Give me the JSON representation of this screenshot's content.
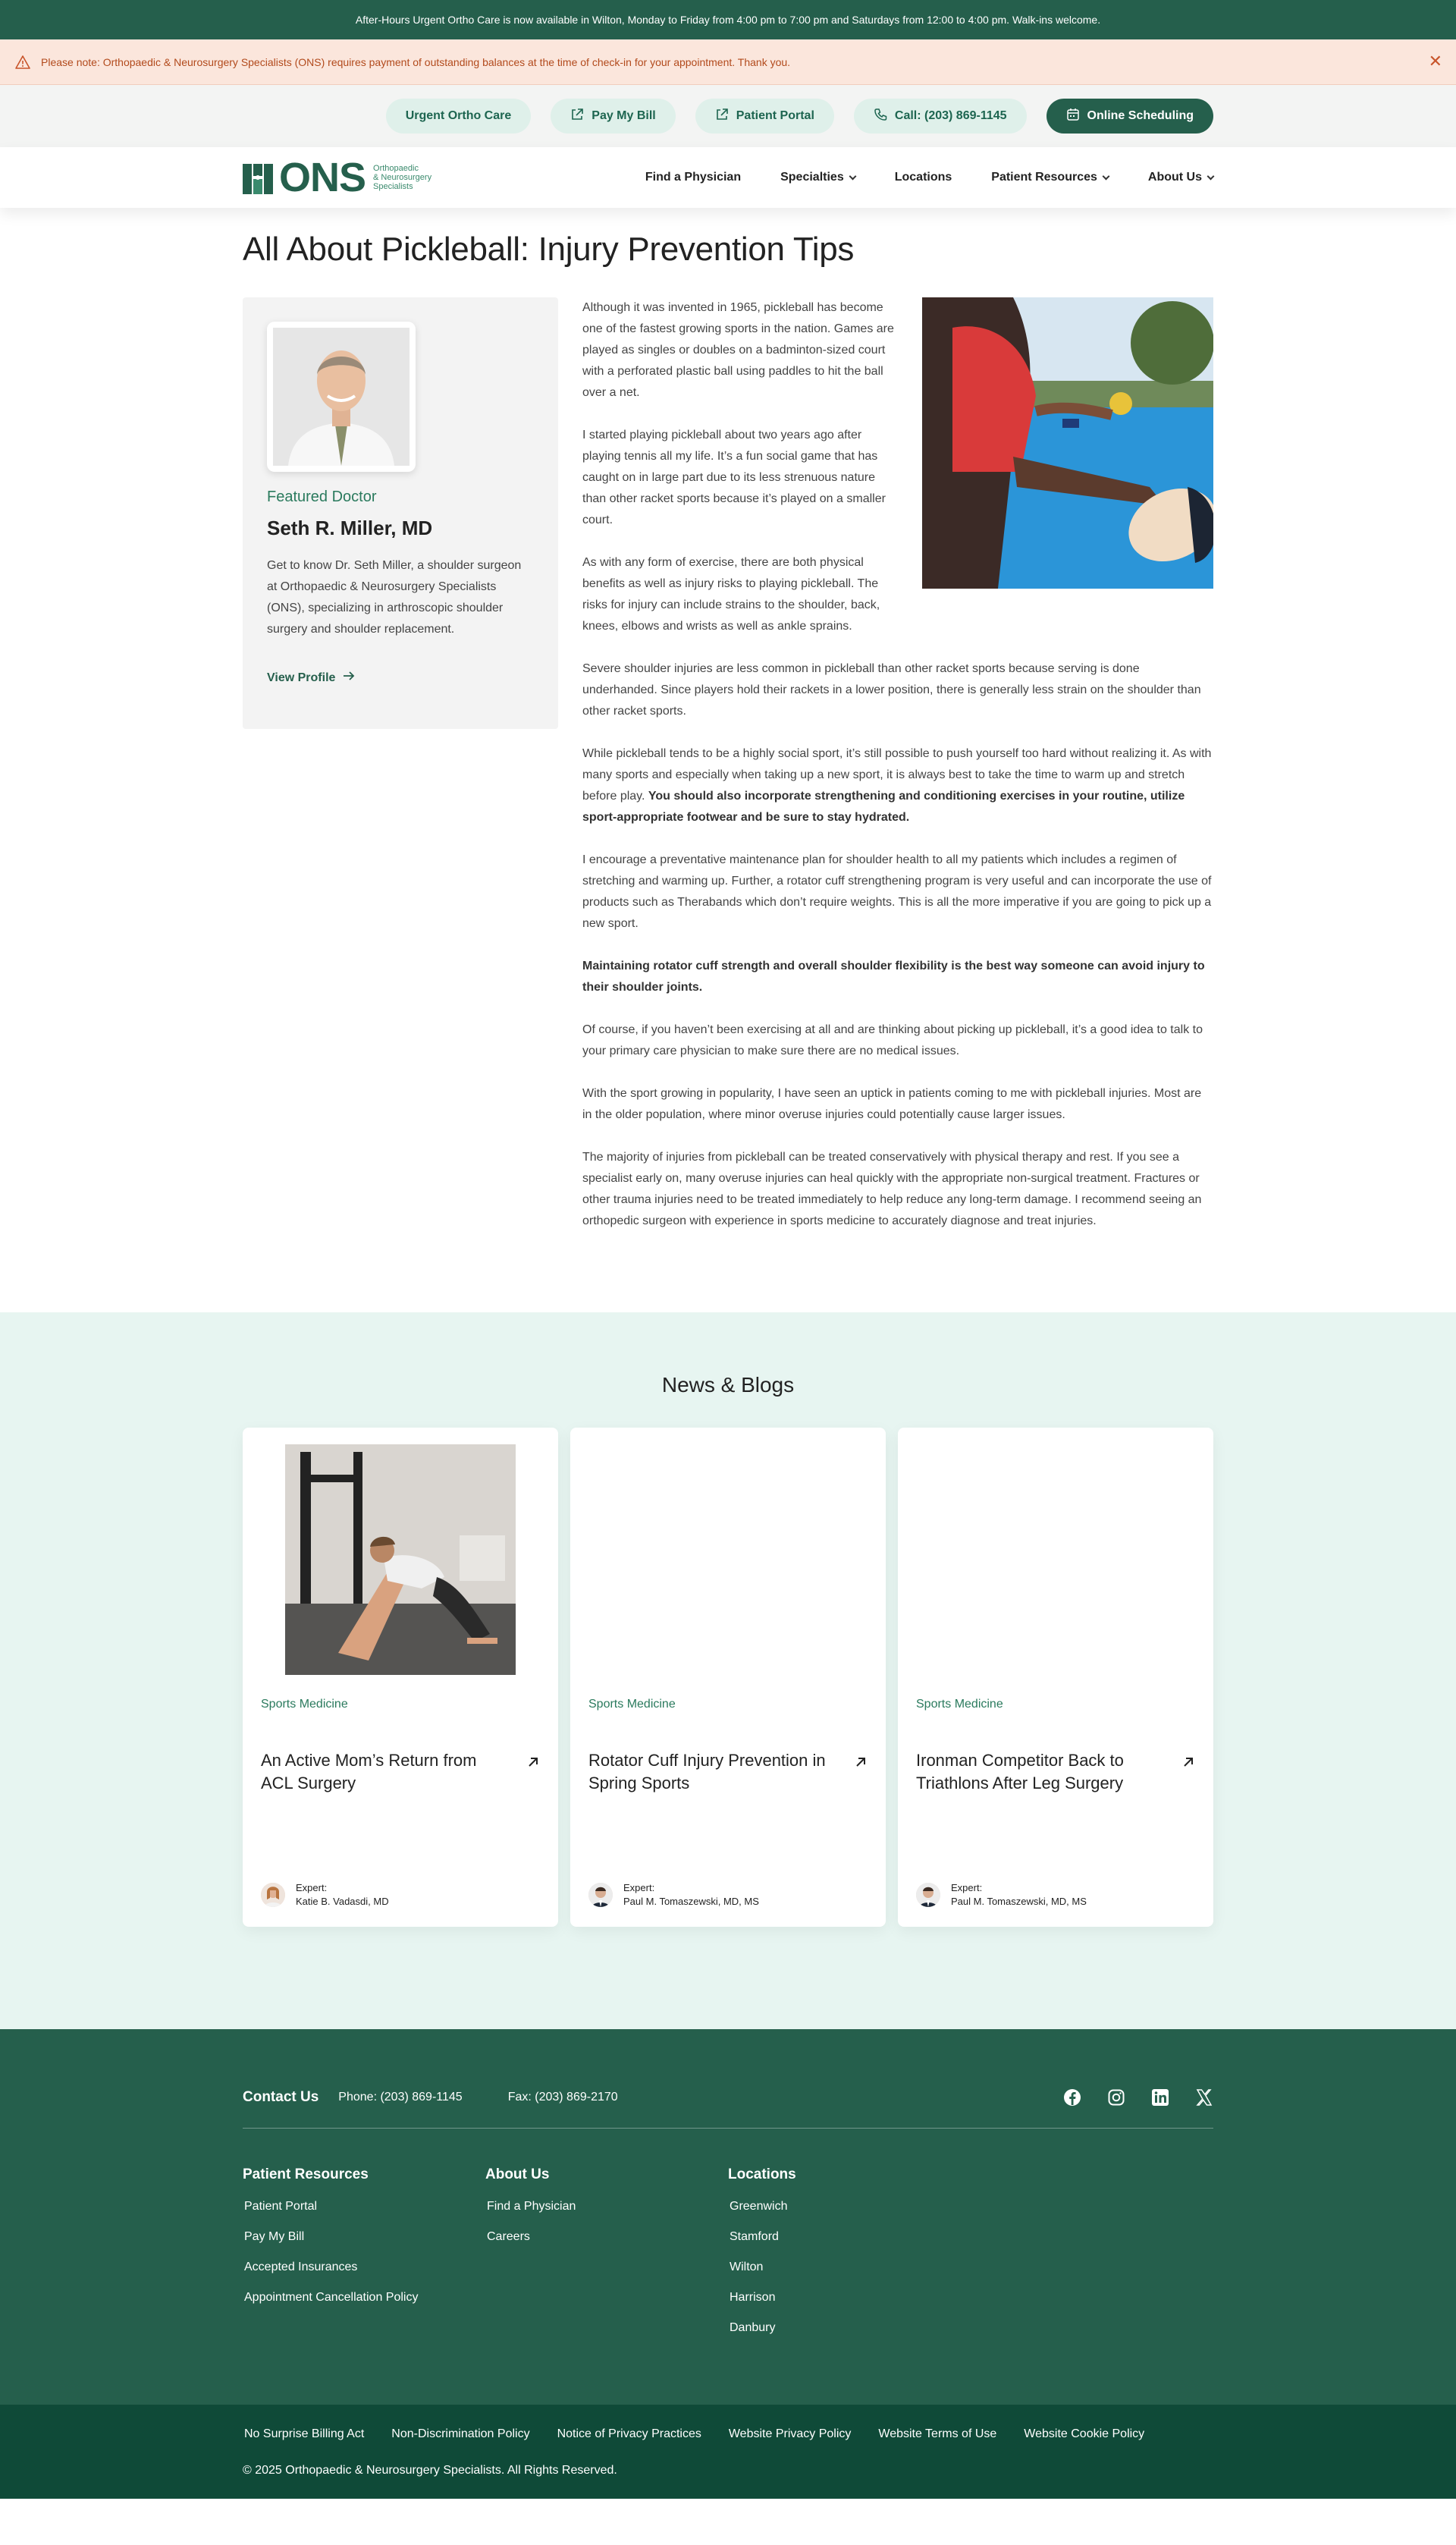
{
  "topbar": {
    "text": "After-Hours Urgent Ortho Care is now available in Wilton, Monday to Friday from 4:00 pm to 7:00 pm and Saturdays from 12:00 to 4:00 pm. Walk-ins welcome."
  },
  "alert": {
    "text": "Please note: Orthopaedic & Neurosurgery Specialists (ONS) requires payment of outstanding balances at the time of check-in for your appointment. Thank you."
  },
  "utility": {
    "urgent": "Urgent Ortho Care",
    "pay": "Pay My Bill",
    "portal": "Patient Portal",
    "call": "Call: (203) 869-1145",
    "schedule": "Online Scheduling"
  },
  "logo": {
    "text": "ONS",
    "sub1": "Orthopaedic",
    "sub2": "& Neurosurgery",
    "sub3": "Specialists"
  },
  "nav": {
    "find": "Find a Physician",
    "specialties": "Specialties",
    "locations": "Locations",
    "resources": "Patient Resources",
    "about": "About Us"
  },
  "article": {
    "title": "All About Pickleball: Injury Prevention Tips",
    "doctor": {
      "label": "Featured Doctor",
      "name": "Seth R. Miller, MD",
      "desc": "Get to know Dr. Seth Miller, a shoulder surgeon at Orthopaedic & Neurosurgery Specialists (ONS), specializing in arthroscopic shoulder surgery and shoulder replacement.",
      "link": "View Profile"
    },
    "p1": "Although it was invented in 1965, pickleball has become one of the fastest growing sports in the nation. Games are played as singles or doubles on a badminton-sized court with a perforated plastic ball using paddles to hit the ball over a net.",
    "p2": "I started playing pickleball about two years ago after playing tennis all my life. It’s a fun social game that has caught on in large part due to its less strenuous nature than other racket sports because it’s played on a smaller court.",
    "p3": "As with any form of exercise, there are both physical benefits as well as injury risks to playing pickleball. The risks for injury can include strains to the shoulder, back, knees, elbows and wrists as well as ankle sprains.",
    "p4": "Severe shoulder injuries are less common in pickleball than other racket sports because serving is done underhanded. Since players hold their rackets in a lower position, there is generally less strain on the shoulder than other racket sports.",
    "p5a": "While pickleball tends to be a highly social sport, it’s still possible to push yourself too hard without realizing it. As with many sports and especially when taking up a new sport, it is always best to take the time to warm up and stretch before play. ",
    "p5b": "You should also incorporate strengthening and conditioning exercises in your routine, utilize sport-appropriate footwear and be sure to stay hydrated.",
    "p6": "I encourage a preventative maintenance plan for shoulder health to all my patients which includes a regimen of stretching and warming up. Further, a rotator cuff strengthening program is very useful and can incorporate the use of products such as Therabands which don’t require weights. This is all the more imperative if you are going to pick up a new sport.",
    "p7": "Maintaining rotator cuff strength and overall shoulder flexibility is the best way someone can avoid injury to their shoulder joints.",
    "p8": "Of course, if you haven’t been exercising at all and are thinking about picking up pickleball, it’s a good idea to talk to your primary care physician to make sure there are no medical issues.",
    "p9": "With the sport growing in popularity, I have seen an uptick in patients coming to me with pickleball injuries. Most are in the older population, where minor overuse injuries could potentially cause larger issues.",
    "p10": "The majority of injuries from pickleball can be treated conservatively with physical therapy and rest. If you see a specialist early on, many overuse injuries can heal quickly with the appropriate non-surgical treatment. Fractures or other trauma injuries need to be treated immediately to help reduce any long-term damage. I recommend seeing an orthopedic surgeon with experience in sports medicine to accurately diagnose and treat injuries."
  },
  "news": {
    "title": "News & Blogs",
    "cards": [
      {
        "category": "Sports Medicine",
        "title": "An Active Mom’s Return from ACL Surgery",
        "expert_label": "Expert:",
        "expert": "Katie B. Vadasdi, MD"
      },
      {
        "category": "Sports Medicine",
        "title": "Rotator Cuff Injury Prevention in Spring Sports",
        "expert_label": "Expert:",
        "expert": "Paul M. Tomaszewski, MD, MS"
      },
      {
        "category": "Sports Medicine",
        "title": "Ironman Competitor Back to Triathlons After Leg Surgery",
        "expert_label": "Expert:",
        "expert": "Paul M. Tomaszewski, MD, MS"
      }
    ]
  },
  "footer": {
    "contact_label": "Contact Us",
    "phone": "Phone: (203) 869-1145",
    "fax": "Fax: (203) 869-2170",
    "col1": {
      "title": "Patient Resources",
      "items": [
        "Patient Portal",
        "Pay My Bill",
        "Accepted Insurances",
        "Appointment Cancellation Policy"
      ]
    },
    "col2": {
      "title": "About Us",
      "items": [
        "Find a Physician",
        "Careers"
      ]
    },
    "col3": {
      "title": "Locations",
      "items": [
        "Greenwich",
        "Stamford",
        "Wilton",
        "Harrison",
        "Danbury"
      ]
    },
    "legal": [
      "No Surprise Billing Act",
      "Non-Discrimination Policy",
      "Notice of Privacy Practices",
      "Website Privacy Policy",
      "Website Terms of Use",
      "Website Cookie Policy"
    ],
    "copyright": "© 2025 Orthopaedic & Neurosurgery Specialists. All Rights Reserved."
  }
}
